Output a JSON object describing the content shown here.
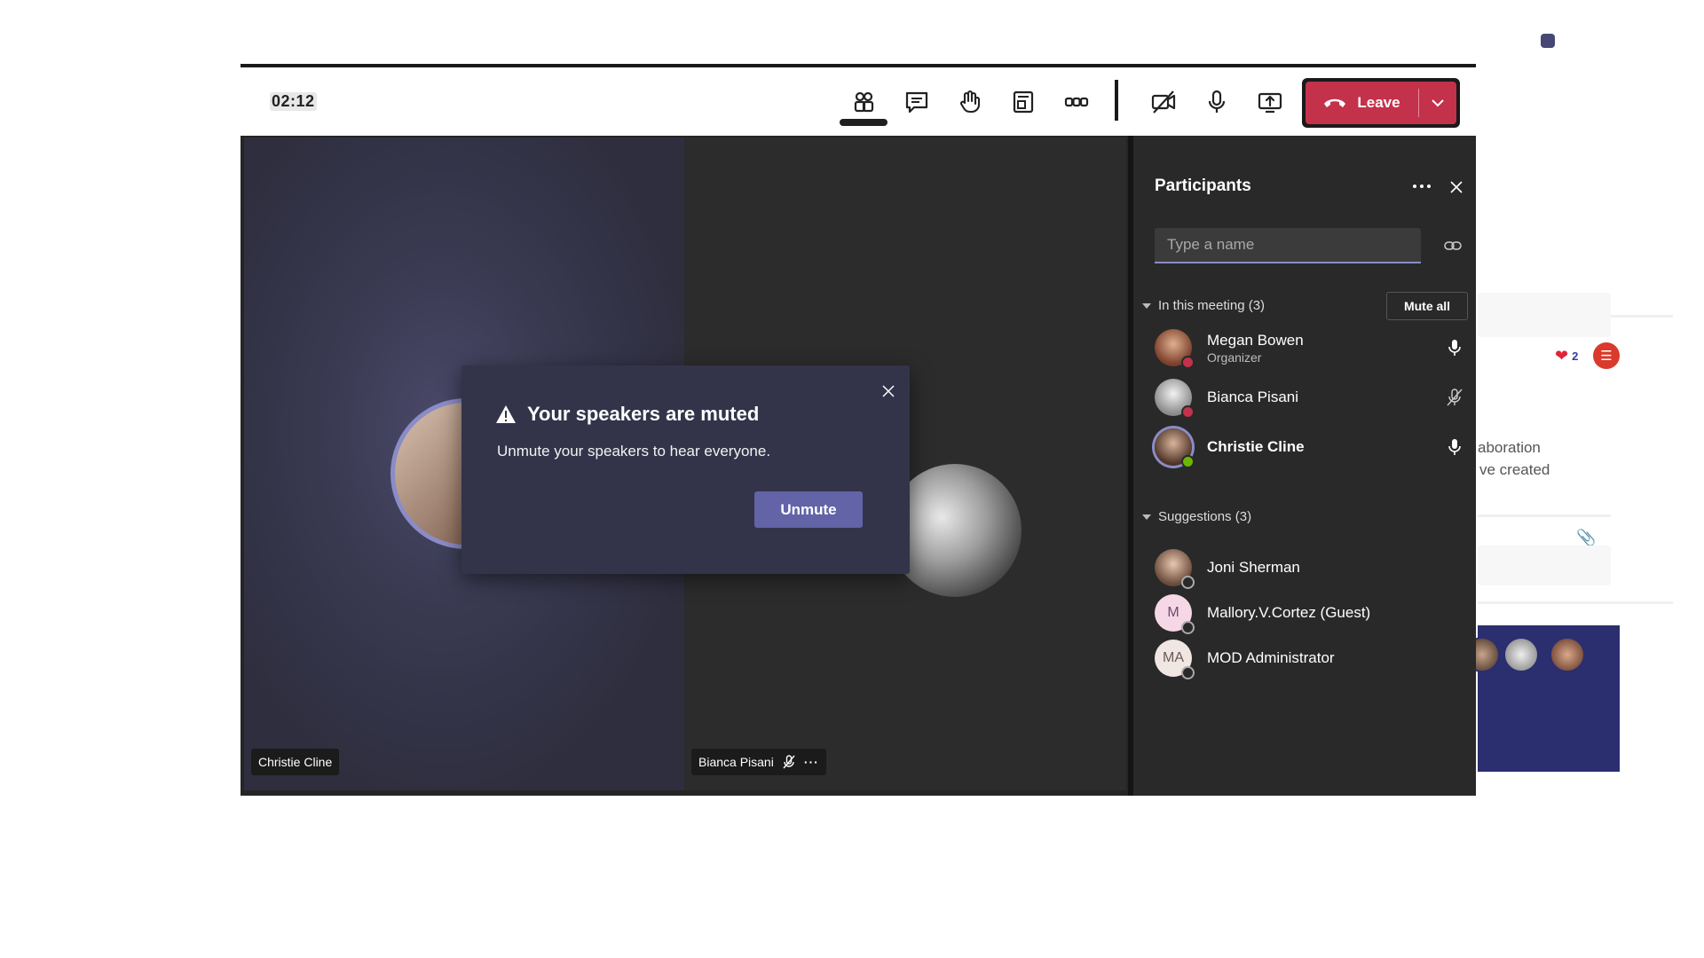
{
  "toolbar": {
    "timer": "02:12",
    "buttons": [
      "show-participants",
      "show-conversation",
      "raise-hand",
      "breakout-rooms",
      "more-actions",
      "camera-off",
      "mic",
      "share-tray"
    ],
    "leave_label": "Leave"
  },
  "stage": {
    "tiles": [
      {
        "name": "Christie Cline"
      },
      {
        "name": "Bianca Pisani",
        "muted": true
      }
    ]
  },
  "dialog": {
    "title": "Your speakers are muted",
    "body": "Unmute your speakers to hear everyone.",
    "button": "Unmute"
  },
  "panel": {
    "title": "Participants",
    "search_placeholder": "Type a name",
    "in_meeting_label": "In this meeting (3)",
    "mute_all_label": "Mute all",
    "suggestions_label": "Suggestions (3)",
    "in_meeting": [
      {
        "name": "Megan Bowen",
        "role": "Organizer",
        "presence": "busy",
        "mic": "on"
      },
      {
        "name": "Bianca Pisani",
        "role": "",
        "presence": "busy",
        "mic": "muted"
      },
      {
        "name": "Christie Cline",
        "role": "",
        "presence": "available",
        "mic": "on"
      }
    ],
    "suggestions": [
      {
        "name": "Joni Sherman",
        "initials": ""
      },
      {
        "name": "Mallory.V.Cortez (Guest)",
        "initials": "M"
      },
      {
        "name": "MOD Administrator",
        "initials": "MA"
      }
    ]
  },
  "background": {
    "text_1": "aboration",
    "text_2": "ve created",
    "reaction_count": "2"
  },
  "colors": {
    "accent": "#6264a7",
    "leave": "#c4314b",
    "busy": "#c4314b",
    "available": "#6bb700",
    "panel": "#292929"
  }
}
